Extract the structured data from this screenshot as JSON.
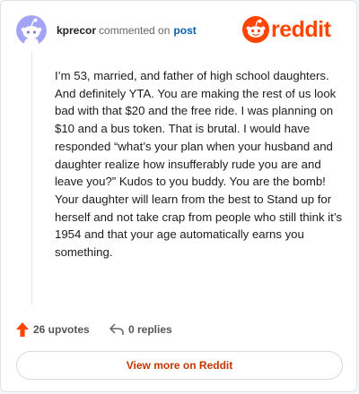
{
  "header": {
    "username": "kprecor",
    "verb": "commented on",
    "link_text": "post",
    "logo_text": "reddit"
  },
  "comment": {
    "body": "I’m 53, married, and father of high school daughters. And definitely YTA. You are making the rest of us look bad with that $20 and the free ride. I was planning on $10 and a bus token. That is brutal. I would have responded “what’s your plan when your husband and daughter realize how insufferably rude you are and leave you?” Kudos to you buddy. You are the bomb! Your daughter will learn from the best to Stand up for herself and not take crap from people who still think it’s 1954 and that your age automatically earns you something."
  },
  "actions": {
    "upvotes": "26 upvotes",
    "replies": "0 replies"
  },
  "footer": {
    "view_more": "View more on Reddit"
  },
  "colors": {
    "brand": "#ff4500",
    "link": "#0b5fa8",
    "avatar_bg": "#a3a4f5"
  },
  "icons": {
    "avatar": "snoo-avatar-icon",
    "logo": "reddit-snoo-icon",
    "upvote": "upvote-arrow-icon",
    "reply": "reply-arrow-icon"
  }
}
